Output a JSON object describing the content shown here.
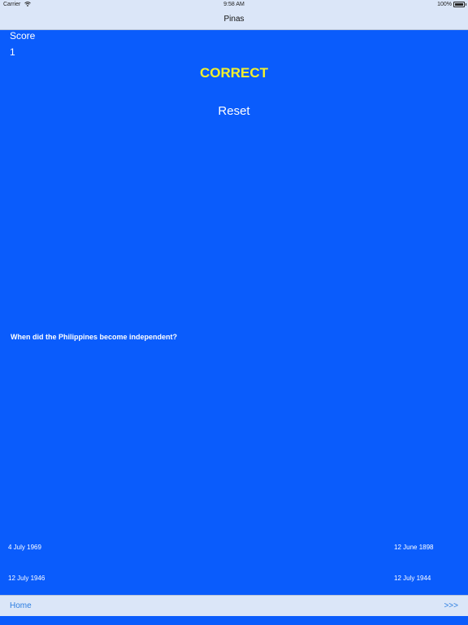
{
  "status_bar": {
    "carrier": "Carrier",
    "time": "9:58 AM",
    "battery": "100%"
  },
  "nav": {
    "title": "Pinas"
  },
  "score": {
    "label": "Score",
    "value": "1"
  },
  "result": {
    "text": "CORRECT",
    "color": "#f4f12c"
  },
  "reset_label": "Reset",
  "question": "When did the Philippines become independent?",
  "answers": [
    "4 July 1969",
    "12 June 1898",
    "12 July 1946",
    "12 July 1944"
  ],
  "toolbar": {
    "home_label": "Home",
    "next_label": ">>>"
  },
  "colors": {
    "background": "#0a5cfc",
    "bar": "#dbe6f8",
    "link": "#2b7de0"
  },
  "icons": {
    "wifi": "wifi-icon",
    "battery": "battery-icon"
  }
}
